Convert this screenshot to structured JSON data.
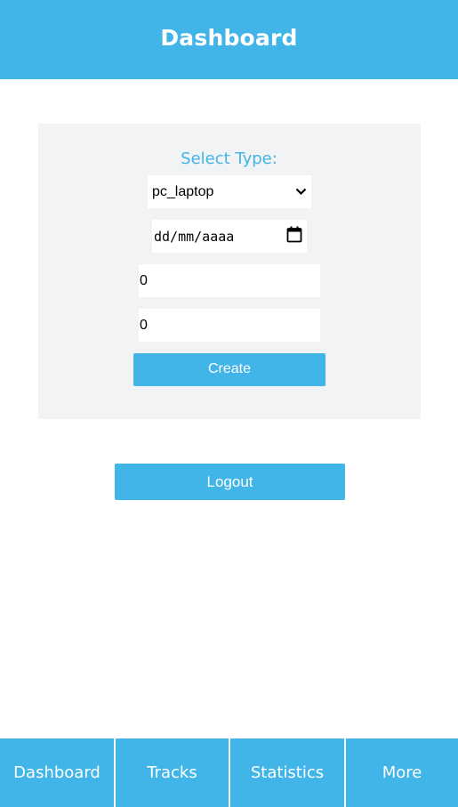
{
  "header": {
    "title": "Dashboard"
  },
  "form": {
    "select_label": "Select Type:",
    "type_value": "pc_laptop",
    "date_placeholder": "dd/mm/aaaa",
    "number_one": "0",
    "number_two": "0",
    "create_label": "Create"
  },
  "logout_label": "Logout",
  "bottom_nav": {
    "items": [
      {
        "label": "Dashboard"
      },
      {
        "label": "Tracks"
      },
      {
        "label": "Statistics"
      },
      {
        "label": "More"
      }
    ]
  },
  "colors": {
    "accent": "#41b4e8",
    "card_background": "#f2f3f4",
    "text_on_accent": "#ffffff"
  },
  "icons": {
    "select_arrow": "chevron-down-icon",
    "date_picker": "calendar-icon"
  }
}
